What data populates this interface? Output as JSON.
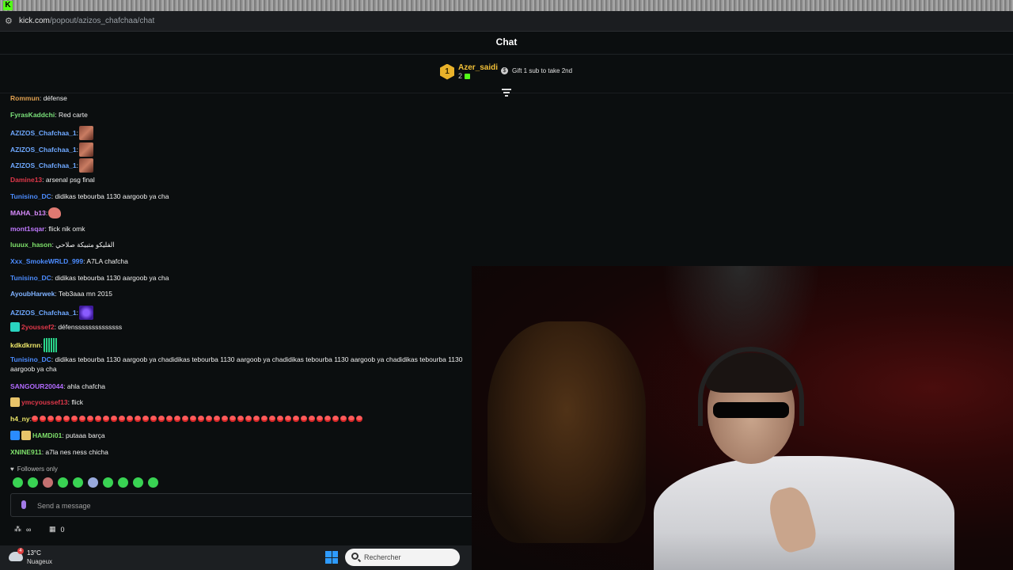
{
  "browser": {
    "tab_icon": "K",
    "url_host": "kick.com",
    "url_path": "/popout/azizos_chafchaa/chat"
  },
  "chat": {
    "title": "Chat",
    "leaderboard": {
      "rank": "1",
      "name": "Azer_saidi",
      "count": "2"
    },
    "gift_text": "Gift 1 sub to take 2nd",
    "messages": [
      {
        "user": "FyrasKaddchi",
        "color": "#7ae07a",
        "text": ": Red carte"
      },
      {
        "user": "AZIZOS_Chafchaa_1",
        "color": "#6ea8ff",
        "text": ": "
      },
      {
        "user": "AZIZOS_Chafchaa_1",
        "color": "#6ea8ff",
        "text": ": "
      },
      {
        "user": "AZIZOS_Chafchaa_1",
        "color": "#6ea8ff",
        "text": ": "
      },
      {
        "user": "Damine13",
        "color": "#e0384a",
        "text": ": arsenal psg final"
      },
      {
        "user": "Tunisino_DC",
        "color": "#4c8cff",
        "text": ": didikas tebourba 1130 aargoob ya cha"
      },
      {
        "user": "MAHA_b13",
        "color": "#d98cff",
        "text": ": "
      },
      {
        "user": "mont1sqar",
        "color": "#c07aff",
        "text": ": flick nik omk"
      },
      {
        "user": "luuux_hason",
        "color": "#7ee06a",
        "text": ": الفليكو متبيكة صلاحي"
      },
      {
        "user": "Xxx_SmokeWRLD_999",
        "color": "#4c8cff",
        "text": ": A7LA chafcha"
      },
      {
        "user": "Tunisino_DC",
        "color": "#4c8cff",
        "text": ": didikas tebourba 1130 aargoob ya cha"
      },
      {
        "user": "AyoubHarwek",
        "color": "#7fb2ff",
        "text": ": Teb3aaa mn 2015"
      },
      {
        "user": "AZIZOS_Chafchaa_1",
        "color": "#6ea8ff",
        "text": ": "
      },
      {
        "user": "2youssef2",
        "color": "#e0384a",
        "text": ": défenssssssssssssss"
      },
      {
        "user": "kdkdkrnn",
        "color": "#f0e96a",
        "text": ": "
      },
      {
        "user": "Tunisino_DC",
        "color": "#4c8cff",
        "text": ": didikas tebourba 1130 aargoob ya chadidikas tebourba 1130 aargoob ya chadidikas tebourba 1130 aargoob ya chadidikas tebourba 1130 aargoob ya cha"
      },
      {
        "user": "SANGOUR20044",
        "color": "#b36bff",
        "text": ": ahla chafcha"
      },
      {
        "user": "ymcyoussef13",
        "color": "#e0384a",
        "text": ": flick"
      },
      {
        "user": "h4_ny",
        "color": "#f0e96a",
        "text": ": "
      },
      {
        "user": "HAMDi01",
        "color": "#7ee06a",
        "text": ": putaaa barça"
      },
      {
        "user": "XNINE911",
        "color": "#7ee06a",
        "text": ": a7la nes ness chicha"
      }
    ],
    "followers_only": "Followers only",
    "input_placeholder": "Send a message",
    "footer": {
      "infinity": "∞",
      "points": "0"
    }
  },
  "taskbar": {
    "weather_temp": "13°C",
    "weather_desc": "Nuageux",
    "weather_badge": "4",
    "search_placeholder": "Rechercher"
  }
}
